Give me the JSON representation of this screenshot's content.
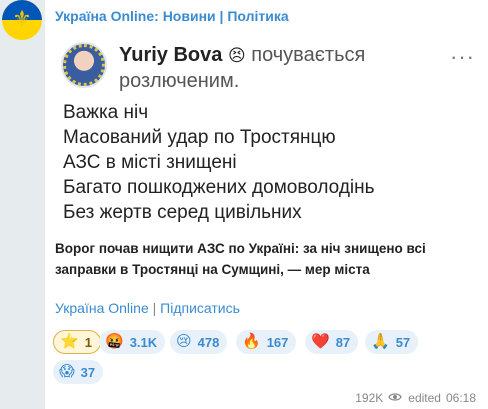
{
  "channel": {
    "name": "Україна Online: Новини | Політика"
  },
  "post": {
    "author_name": "Yuriy Bova",
    "feeling_emoji": "😣",
    "feeling_line1": "почувається",
    "feeling_line2": "розлюченим.",
    "lines": [
      "Важка ніч",
      "Масований удар по Тростянцю",
      "АЗС в місті знищені",
      "Багато пошкоджених домоволодінь",
      "Без жертв серед цивільних"
    ],
    "headline_1": "Ворог почав нищити АЗС по Україні: за ніч знищено всі",
    "headline_2": "заправки в Тростянці на Сумщині, — мер міста",
    "footer_channel": "Україна Online",
    "footer_sep": "|",
    "footer_subscribe": "Підписатись"
  },
  "reactions": [
    {
      "icon": "⭐",
      "count": "1"
    },
    {
      "icon": "🤬",
      "count": "3.1K"
    },
    {
      "icon": "😢",
      "count": "478"
    },
    {
      "icon": "🔥",
      "count": "167"
    },
    {
      "icon": "❤️",
      "count": "87"
    },
    {
      "icon": "🙏",
      "count": "57"
    },
    {
      "icon": "😱",
      "count": "37"
    }
  ],
  "meta": {
    "views": "192K",
    "edited": "edited",
    "time": "06:18"
  }
}
